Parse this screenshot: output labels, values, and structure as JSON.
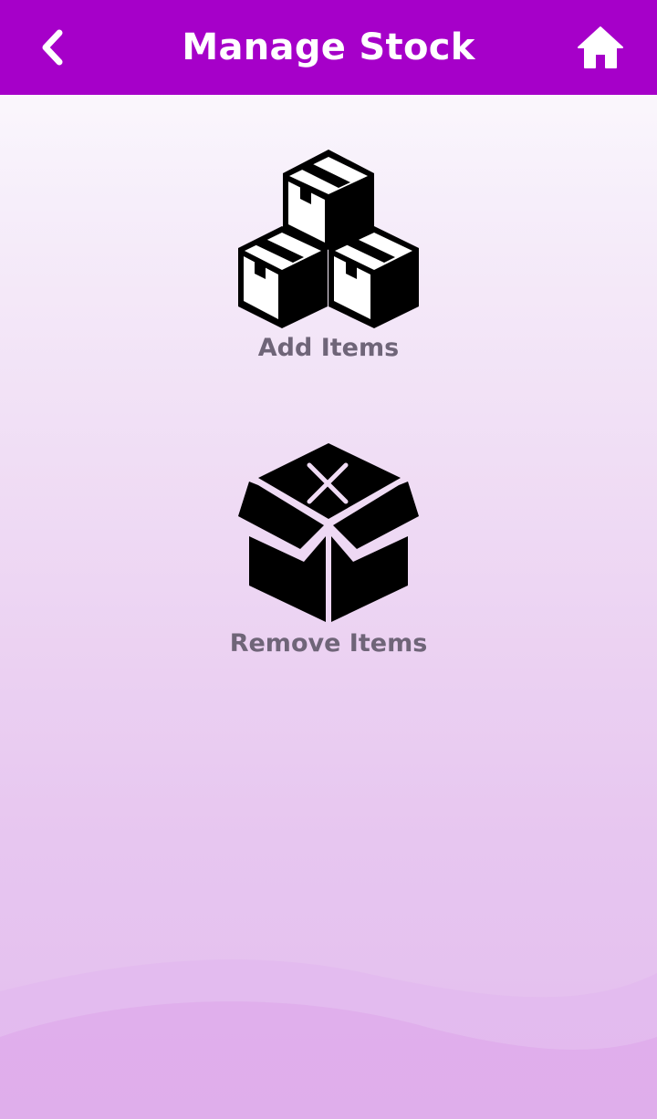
{
  "header": {
    "title": "Manage Stock",
    "back_icon": "chevron-left-icon",
    "home_icon": "home-icon",
    "background_color": "#a600c9"
  },
  "menu": {
    "items": [
      {
        "label": "Add Items",
        "icon": "stacked-boxes-icon"
      },
      {
        "label": "Remove Items",
        "icon": "box-x-icon"
      }
    ]
  },
  "colors": {
    "label_text": "#6f6578",
    "icon": "#000000",
    "background_top": "#ffffff",
    "background_bottom": "#e3bdee"
  }
}
